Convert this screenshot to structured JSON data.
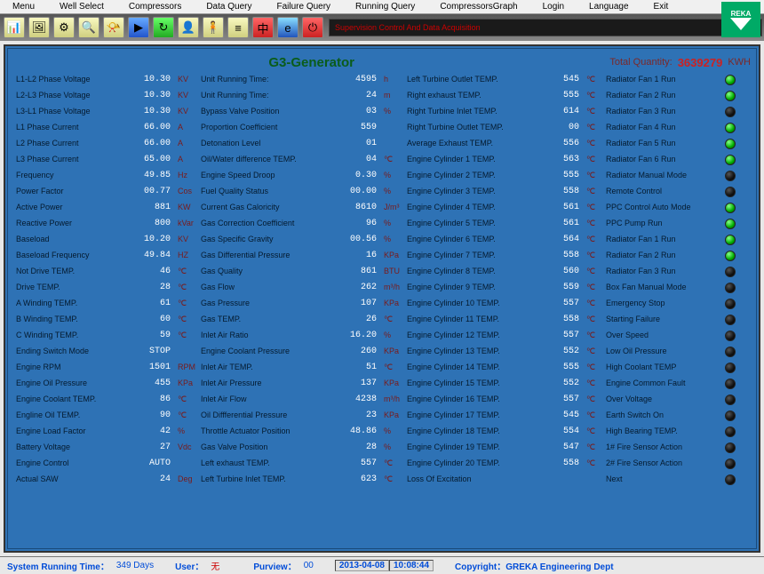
{
  "menu": [
    "Menu",
    "Well Select",
    "Compressors",
    "Data Query",
    "Failure Query",
    "Running Query",
    "CompressorsGraph",
    "Login",
    "Language",
    "Exit"
  ],
  "logo": "REKA",
  "banner": "Supervision Control And Data Acquisition",
  "title": "G3-Generator",
  "total_label": "Total Quantity:",
  "total_value": "3639279",
  "total_unit": "KWH",
  "col1": [
    {
      "l": "L1-L2 Phase Voltage",
      "v": "10.30",
      "u": "KV"
    },
    {
      "l": "L2-L3 Phase Voltage",
      "v": "10.30",
      "u": "KV"
    },
    {
      "l": "L3-L1 Phase Voltage",
      "v": "10.30",
      "u": "KV"
    },
    {
      "l": "L1 Phase Current",
      "v": "66.00",
      "u": "A"
    },
    {
      "l": "L2 Phase Current",
      "v": "66.00",
      "u": "A"
    },
    {
      "l": "L3 Phase Current",
      "v": "65.00",
      "u": "A"
    },
    {
      "l": "Frequency",
      "v": "49.85",
      "u": "Hz"
    },
    {
      "l": "Power Factor",
      "v": "00.77",
      "u": "Cos"
    },
    {
      "l": "Active Power",
      "v": "881",
      "u": "KW"
    },
    {
      "l": "Reactive Power",
      "v": "800",
      "u": "kVar"
    },
    {
      "l": "Baseload",
      "v": "10.20",
      "u": "KV"
    },
    {
      "l": "Baseload Frequency",
      "v": "49.84",
      "u": "HZ"
    },
    {
      "l": "Not Drive TEMP.",
      "v": "46",
      "u": "℃"
    },
    {
      "l": "Drive TEMP.",
      "v": "28",
      "u": "℃"
    },
    {
      "l": "A Winding TEMP.",
      "v": "61",
      "u": "℃"
    },
    {
      "l": "B Winding TEMP.",
      "v": "60",
      "u": "℃"
    },
    {
      "l": "C Winding TEMP.",
      "v": "59",
      "u": "℃"
    },
    {
      "l": "Ending Switch Mode",
      "v": "STOP",
      "u": ""
    },
    {
      "l": "Engine RPM",
      "v": "1501",
      "u": "RPM"
    },
    {
      "l": "Engine Oil Pressure",
      "v": "455",
      "u": "KPa"
    },
    {
      "l": "Engine Coolant TEMP.",
      "v": "86",
      "u": "℃"
    },
    {
      "l": "Engline Oil TEMP.",
      "v": "90",
      "u": "℃"
    },
    {
      "l": "Engine Load Factor",
      "v": "42",
      "u": "%"
    },
    {
      "l": "Battery Voltage",
      "v": "27",
      "u": "Vdc"
    },
    {
      "l": "Engine Control",
      "v": "AUTO",
      "u": ""
    },
    {
      "l": "Actual SAW",
      "v": "24",
      "u": "Deg"
    }
  ],
  "col2": [
    {
      "l": "Unit Running Time:",
      "v": "4595",
      "u": "h"
    },
    {
      "l": "Unit Running Time:",
      "v": "24",
      "u": "m"
    },
    {
      "l": "Bypass Valve Position",
      "v": "03",
      "u": "%"
    },
    {
      "l": "Proportion Coefficient",
      "v": "559",
      "u": ""
    },
    {
      "l": "Detonation Level",
      "v": "01",
      "u": ""
    },
    {
      "l": "Oil/Water difference TEMP.",
      "v": "04",
      "u": "℃"
    },
    {
      "l": "Engine Speed Droop",
      "v": "0.30",
      "u": "%"
    },
    {
      "l": "Fuel Quality Status",
      "v": "00.00",
      "u": "%"
    },
    {
      "l": "Current Gas Caloricity",
      "v": "8610",
      "u": "J/m³"
    },
    {
      "l": "Gas Correction Coefficient",
      "v": "96",
      "u": "%"
    },
    {
      "l": "Gas Specific Gravity",
      "v": "00.56",
      "u": "%"
    },
    {
      "l": "Gas Differential Pressure",
      "v": "16",
      "u": "KPa"
    },
    {
      "l": "Gas Quality",
      "v": "861",
      "u": "BTU"
    },
    {
      "l": "Gas Flow",
      "v": "262",
      "u": "m³/h"
    },
    {
      "l": "Gas Pressure",
      "v": "107",
      "u": "KPa"
    },
    {
      "l": "Gas TEMP.",
      "v": "26",
      "u": "℃"
    },
    {
      "l": "Inlet Air Ratio",
      "v": "16.20",
      "u": "%"
    },
    {
      "l": "Engine Coolant Pressure",
      "v": "260",
      "u": "KPa"
    },
    {
      "l": "Inlet Air TEMP.",
      "v": "51",
      "u": "℃"
    },
    {
      "l": "Inlet Air Pressure",
      "v": "137",
      "u": "KPa"
    },
    {
      "l": "Inlet Air Flow",
      "v": "4238",
      "u": "m³/h"
    },
    {
      "l": "Oil Diffferential Pressure",
      "v": "23",
      "u": "KPa"
    },
    {
      "l": "Throttle Actuator Position",
      "v": "48.86",
      "u": "%"
    },
    {
      "l": "Gas Valve Position",
      "v": "28",
      "u": "%"
    },
    {
      "l": "Left exhaust TEMP.",
      "v": "557",
      "u": "℃"
    },
    {
      "l": "Left Turbine Inlet TEMP.",
      "v": "623",
      "u": "℃"
    }
  ],
  "col3": [
    {
      "l": "Left Turbine Outlet TEMP.",
      "v": "545",
      "u": "℃"
    },
    {
      "l": "Right exhaust TEMP.",
      "v": "555",
      "u": "℃"
    },
    {
      "l": "Right Turbine Inlet TEMP.",
      "v": "614",
      "u": "℃"
    },
    {
      "l": "Right Turbine Outlet TEMP.",
      "v": "00",
      "u": "℃"
    },
    {
      "l": "Average Exhaust TEMP.",
      "v": "556",
      "u": "℃"
    },
    {
      "l": "Engine Cylinder 1 TEMP.",
      "v": "563",
      "u": "℃"
    },
    {
      "l": "Engine Cylinder 2 TEMP.",
      "v": "555",
      "u": "℃"
    },
    {
      "l": "Engine Cylinder 3 TEMP.",
      "v": "558",
      "u": "℃"
    },
    {
      "l": "Engine Cylinder 4 TEMP.",
      "v": "561",
      "u": "℃"
    },
    {
      "l": "Engine Cylinder 5 TEMP.",
      "v": "561",
      "u": "℃"
    },
    {
      "l": "Engine Cylinder 6 TEMP.",
      "v": "564",
      "u": "℃"
    },
    {
      "l": "Engine Cylinder 7 TEMP.",
      "v": "558",
      "u": "℃"
    },
    {
      "l": "Engine Cylinder 8 TEMP.",
      "v": "560",
      "u": "℃"
    },
    {
      "l": "Engine Cylinder 9 TEMP.",
      "v": "559",
      "u": "℃"
    },
    {
      "l": "Engine Cylinder 10 TEMP.",
      "v": "557",
      "u": "℃"
    },
    {
      "l": "Engine Cylinder 11 TEMP.",
      "v": "558",
      "u": "℃"
    },
    {
      "l": "Engine Cylinder 12 TEMP.",
      "v": "557",
      "u": "℃"
    },
    {
      "l": "Engine Cylinder 13 TEMP.",
      "v": "552",
      "u": "℃"
    },
    {
      "l": "Engine Cylinder 14 TEMP.",
      "v": "555",
      "u": "℃"
    },
    {
      "l": "Engine Cylinder 15 TEMP.",
      "v": "552",
      "u": "℃"
    },
    {
      "l": "Engine Cylinder 16 TEMP.",
      "v": "557",
      "u": "℃"
    },
    {
      "l": "Engine Cylinder 17 TEMP.",
      "v": "545",
      "u": "℃"
    },
    {
      "l": "Engine Cylinder 18 TEMP.",
      "v": "554",
      "u": "℃"
    },
    {
      "l": "Engine Cylinder 19 TEMP.",
      "v": "547",
      "u": "℃"
    },
    {
      "l": "Engine Cylinder 20 TEMP.",
      "v": "558",
      "u": "℃"
    },
    {
      "l": "Loss Of Excitation",
      "v": "",
      "u": ""
    }
  ],
  "col4": [
    {
      "l": "Radiator Fan 1 Run",
      "led": "g"
    },
    {
      "l": "Radiator Fan 2 Run",
      "led": "g"
    },
    {
      "l": "Radiator Fan 3 Run",
      "led": "d"
    },
    {
      "l": "Radiator Fan 4 Run",
      "led": "g"
    },
    {
      "l": "Radiator Fan 5 Run",
      "led": "g"
    },
    {
      "l": "Radiator Fan 6 Run",
      "led": "g"
    },
    {
      "l": "Radiator Manual Mode",
      "led": "d"
    },
    {
      "l": "Remote Control",
      "led": "d"
    },
    {
      "l": "PPC Control Auto Mode",
      "led": "g"
    },
    {
      "l": "PPC Pump Run",
      "led": "g"
    },
    {
      "l": "Radiator Fan 1 Run",
      "led": "g"
    },
    {
      "l": "Radiator Fan 2 Run",
      "led": "g"
    },
    {
      "l": "Radiator Fan 3 Run",
      "led": "d"
    },
    {
      "l": "Box Fan Manual Mode",
      "led": "d"
    },
    {
      "l": "Emergency Stop",
      "led": "d"
    },
    {
      "l": "Starting Failure",
      "led": "d"
    },
    {
      "l": "Over Speed",
      "led": "d"
    },
    {
      "l": "Low Oil Pressure",
      "led": "d"
    },
    {
      "l": "High Coolant TEMP",
      "led": "d"
    },
    {
      "l": "Engine Common Fault",
      "led": "d"
    },
    {
      "l": "Over Voltage",
      "led": "d"
    },
    {
      "l": "Earth Switch On",
      "led": "d"
    },
    {
      "l": "High Bearing TEMP.",
      "led": "d"
    },
    {
      "l": "1# Fire Sensor Action",
      "led": "d"
    },
    {
      "l": "2# Fire Sensor Action",
      "led": "d"
    },
    {
      "l": "Next",
      "led": "d"
    }
  ],
  "status": {
    "srt_l": "System Running Time：",
    "srt_v": "349 Days",
    "user_l": "User：",
    "user_v": "无",
    "pv_l": "Purview：",
    "pv_v": "00",
    "date": "2013-04-08",
    "time": "10:08:44",
    "cr": "Copyright：GREKA Engineering Dept"
  }
}
